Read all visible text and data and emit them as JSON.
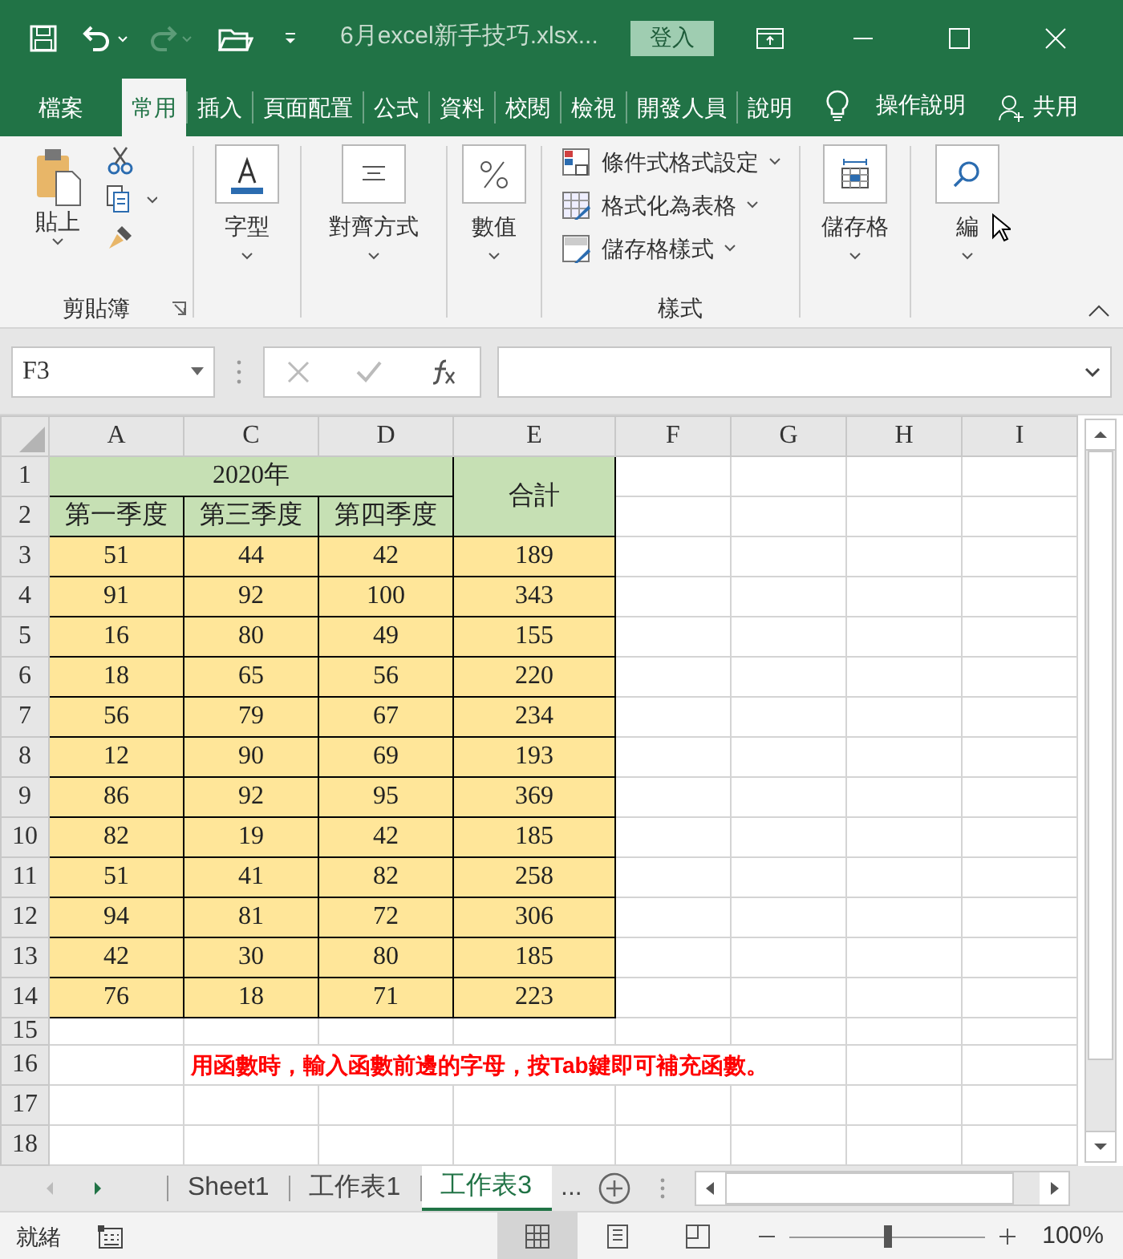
{
  "title_bar": {
    "filename": "6月excel新手技巧.xlsx...",
    "sign_in": "登入"
  },
  "ribbon_tabs": [
    {
      "label": "檔案",
      "selected": false
    },
    {
      "label": "常用",
      "selected": true
    },
    {
      "label": "插入",
      "selected": false
    },
    {
      "label": "頁面配置",
      "selected": false
    },
    {
      "label": "公式",
      "selected": false
    },
    {
      "label": "資料",
      "selected": false
    },
    {
      "label": "校閱",
      "selected": false
    },
    {
      "label": "檢視",
      "selected": false
    },
    {
      "label": "開發人員",
      "selected": false
    },
    {
      "label": "說明",
      "selected": false
    }
  ],
  "tell_me": "操作說明",
  "share": "共用",
  "ribbon": {
    "paste": "貼上",
    "clipboard_group": "剪貼簿",
    "font": "字型",
    "alignment": "對齊方式",
    "number": "數值",
    "styles": [
      "條件式格式設定",
      "格式化為表格",
      "儲存格樣式"
    ],
    "styles_group": "樣式",
    "cells": "儲存格",
    "editing": "編"
  },
  "name_box": "F3",
  "column_headers": [
    "A",
    "C",
    "D",
    "E",
    "F",
    "G",
    "H",
    "I"
  ],
  "table": {
    "header": "2020年",
    "total_header": "合計",
    "quarters": [
      "第一季度",
      "第三季度",
      "第四季度"
    ],
    "rows": [
      {
        "row": "3",
        "values": [
          "51",
          "44",
          "42"
        ],
        "total": "189"
      },
      {
        "row": "4",
        "values": [
          "91",
          "92",
          "100"
        ],
        "total": "343"
      },
      {
        "row": "5",
        "values": [
          "16",
          "80",
          "49"
        ],
        "total": "155"
      },
      {
        "row": "6",
        "values": [
          "18",
          "65",
          "56"
        ],
        "total": "220"
      },
      {
        "row": "7",
        "values": [
          "56",
          "79",
          "67"
        ],
        "total": "234"
      },
      {
        "row": "8",
        "values": [
          "12",
          "90",
          "69"
        ],
        "total": "193"
      },
      {
        "row": "9",
        "values": [
          "86",
          "92",
          "95"
        ],
        "total": "369"
      },
      {
        "row": "10",
        "values": [
          "82",
          "19",
          "42"
        ],
        "total": "185"
      },
      {
        "row": "11",
        "values": [
          "51",
          "41",
          "82"
        ],
        "total": "258"
      },
      {
        "row": "12",
        "values": [
          "94",
          "81",
          "72"
        ],
        "total": "306"
      },
      {
        "row": "13",
        "values": [
          "42",
          "30",
          "80"
        ],
        "total": "185"
      },
      {
        "row": "14",
        "values": [
          "76",
          "18",
          "71"
        ],
        "total": "223"
      }
    ]
  },
  "extra_rows": [
    {
      "row": "15"
    },
    {
      "row": "16",
      "note": "用函數時，輸入函數前邊的字母，按Tab鍵即可補充函數。"
    },
    {
      "row": "17"
    },
    {
      "row": "18"
    }
  ],
  "header_rows": [
    "1",
    "2"
  ],
  "sheet_tabs": [
    {
      "label": "Sheet1",
      "selected": false
    },
    {
      "label": "工作表1",
      "selected": false
    },
    {
      "label": "工作表3",
      "selected": true
    }
  ],
  "more_sheets": "...",
  "status_bar": {
    "ready": "就緒",
    "views": [
      {
        "kind": "normal",
        "selected": true
      },
      {
        "kind": "page_layout",
        "selected": false
      },
      {
        "kind": "page_break",
        "selected": false
      }
    ],
    "zoom": {
      "level": 0.5
    },
    "zoom_text": "100%"
  }
}
